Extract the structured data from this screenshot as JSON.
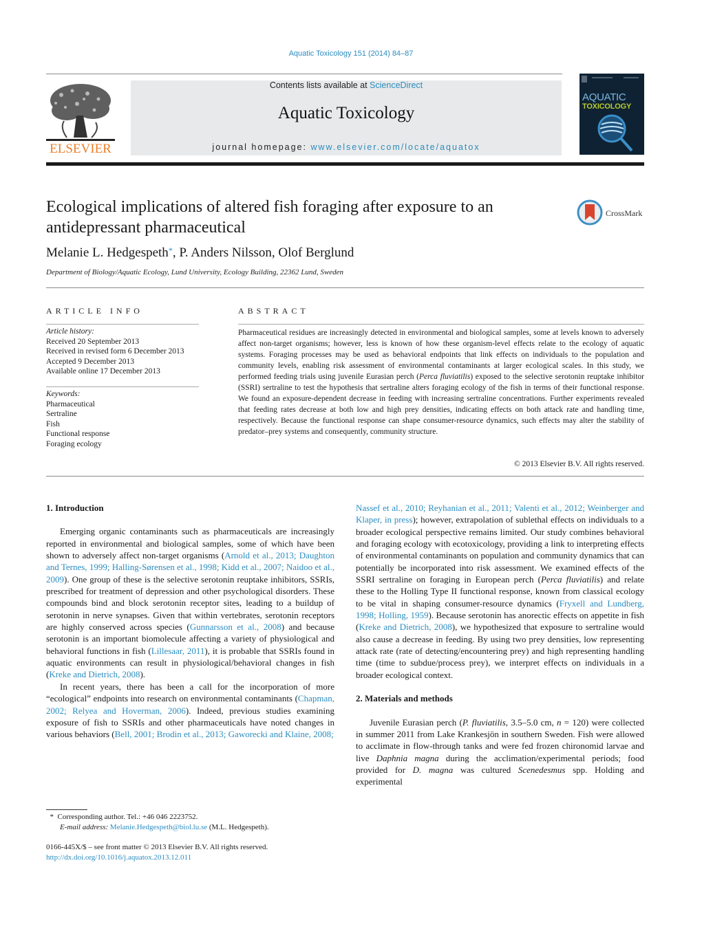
{
  "running_head": "Aquatic Toxicology 151 (2014) 84–87",
  "masthead": {
    "publisher_wordmark": "ELSEVIER",
    "contents_prefix": "Contents lists available at ",
    "contents_link": "ScienceDirect",
    "journal_title": "Aquatic Toxicology",
    "homepage_prefix": "journal homepage: ",
    "homepage_link": "www.elsevier.com/locate/aquatox",
    "cover_line1": "AQUATIC",
    "cover_line2": "TOXICOLOGY",
    "colors": {
      "link": "#2a8cbf",
      "elsevier_orange": "#f07e26",
      "cover_bg": "#0f2233",
      "masthead_bg": "#e8e9ea"
    }
  },
  "article": {
    "title": "Ecological implications of altered fish foraging after exposure to an antidepressant pharmaceutical",
    "crossmark_label": "CrossMark",
    "authors": {
      "first": "Melanie L. Hedgespeth",
      "first_marker": "*",
      "rest": ", P. Anders Nilsson, Olof Berglund"
    },
    "affiliation": "Department of Biology/Aquatic Ecology, Lund University, Ecology Building, 22362 Lund, Sweden"
  },
  "article_info": {
    "heading": "ARTICLE INFO",
    "history_label": "Article history:",
    "history": [
      "Received 20 September 2013",
      "Received in revised form 6 December 2013",
      "Accepted 9 December 2013",
      "Available online 17 December 2013"
    ],
    "keywords_label": "Keywords:",
    "keywords": [
      "Pharmaceutical",
      "Sertraline",
      "Fish",
      "Functional response",
      "Foraging ecology"
    ]
  },
  "abstract": {
    "heading": "ABSTRACT",
    "part1": "Pharmaceutical residues are increasingly detected in environmental and biological samples, some at levels known to adversely affect non-target organisms; however, less is known of how these organism-level effects relate to the ecology of aquatic systems. Foraging processes may be used as behavioral endpoints that link effects on individuals to the population and community levels, enabling risk assessment of environmental contaminants at larger ecological scales. In this study, we performed feeding trials using juvenile Eurasian perch (",
    "species": "Perca fluviatilis",
    "part2": ") exposed to the selective serotonin reuptake inhibitor (SSRI) sertraline to test the hypothesis that sertraline alters foraging ecology of the fish in terms of their functional response. We found an exposure-dependent decrease in feeding with increasing sertraline concentrations. Further experiments revealed that feeding rates decrease at both low and high prey densities, indicating effects on both attack rate and handling time, respectively. Because the functional response can shape consumer-resource dynamics, such effects may alter the stability of predator–prey systems and consequently, community structure.",
    "copyright": "© 2013 Elsevier B.V. All rights reserved."
  },
  "intro": {
    "heading": "1.  Introduction",
    "p1": [
      {
        "t": "Emerging organic contaminants such as pharmaceuticals are increasingly reported in environmental and biological samples, some of which have been shown to adversely affect non-target organisms ("
      },
      {
        "t": "Arnold et al., 2013; Daughton and Ternes, 1999; Halling-Sørensen et al., 1998; Kidd et al., 2007; Naidoo et al., 2009",
        "link": true
      },
      {
        "t": "). One group of these is the selective serotonin reuptake inhibitors, SSRIs, prescribed for treatment of depression and other psychological disorders. These compounds bind and block serotonin receptor sites, leading to a buildup of serotonin in nerve synapses. Given that within vertebrates, serotonin receptors are highly conserved across species ("
      },
      {
        "t": "Gunnarsson et al., 2008",
        "link": true
      },
      {
        "t": ") and because serotonin is an important biomolecule affecting a variety of physiological and behavioral functions in fish ("
      },
      {
        "t": "Lillesaar, 2011",
        "link": true
      },
      {
        "t": "), it is probable that SSRIs found in aquatic environments can result in physiological/behavioral changes in fish ("
      },
      {
        "t": "Kreke and Dietrich, 2008",
        "link": true
      },
      {
        "t": ")."
      }
    ],
    "p2": [
      {
        "t": "In recent years, there has been a call for the incorporation of more “ecological” endpoints into research on environmental contaminants ("
      },
      {
        "t": "Chapman, 2002; Relyea and Hoverman, 2006",
        "link": true
      },
      {
        "t": "). Indeed, previous studies examining exposure of fish to SSRIs and other pharmaceuticals have noted changes in various behaviors ("
      },
      {
        "t": "Bell, 2001; Brodin et al., 2013; Gaworecki and Klaine, 2008;",
        "link": true
      }
    ],
    "p2_cont": [
      {
        "t": "Nassef et al., 2010; Reyhanian et al., 2011; Valenti et al., 2012; Weinberger and Klaper, in press",
        "link": true
      },
      {
        "t": "); however, extrapolation of sublethal effects on individuals to a broader ecological perspective remains limited. Our study combines behavioral and foraging ecology with ecotoxicology, providing a link to interpreting effects of environmental contaminants on population and community dynamics that can potentially be incorporated into risk assessment. We examined effects of the SSRI sertraline on foraging in European perch ("
      },
      {
        "t": "Perca fluviatilis",
        "italic": true
      },
      {
        "t": ") and relate these to the Holling Type II functional response, known from classical ecology to be vital in shaping consumer-resource dynamics ("
      },
      {
        "t": "Fryxell and Lundberg, 1998; Holling, 1959",
        "link": true
      },
      {
        "t": "). Because serotonin has anorectic effects on appetite in fish ("
      },
      {
        "t": "Kreke and Dietrich, 2008",
        "link": true
      },
      {
        "t": "), we hypothesized that exposure to sertraline would also cause a decrease in feeding. By using two prey densities, low representing attack rate (rate of detecting/encountering prey) and high representing handling time (time to subdue/process prey), we interpret effects on individuals in a broader ecological context."
      }
    ]
  },
  "methods": {
    "heading": "2.  Materials and methods",
    "p1": [
      {
        "t": "Juvenile Eurasian perch ("
      },
      {
        "t": "P. fluviatilis",
        "italic": true
      },
      {
        "t": ", 3.5–5.0 cm, "
      },
      {
        "t": "n",
        "italic": true
      },
      {
        "t": " = 120) were collected in summer 2011 from Lake Krankesjön in southern Sweden. Fish were allowed to acclimate in flow-through tanks and were fed frozen chironomid larvae and live "
      },
      {
        "t": "Daphnia magna",
        "italic": true
      },
      {
        "t": " during the acclimation/experimental periods; food provided for "
      },
      {
        "t": "D. magna",
        "italic": true
      },
      {
        "t": " was cultured "
      },
      {
        "t": "Scenedesmus",
        "italic": true
      },
      {
        "t": " spp. Holding and experimental"
      }
    ]
  },
  "footnotes": {
    "marker": "*",
    "corresponding": "Corresponding author. Tel.: +46 046 2223752.",
    "email_label": "E-mail address:",
    "email": "Melanie.Hedgespeth@biol.lu.se",
    "email_suffix": " (M.L. Hedgespeth).",
    "issn_line": "0166-445X/$ – see front matter © 2013 Elsevier B.V. All rights reserved.",
    "doi": "http://dx.doi.org/10.1016/j.aquatox.2013.12.011"
  }
}
